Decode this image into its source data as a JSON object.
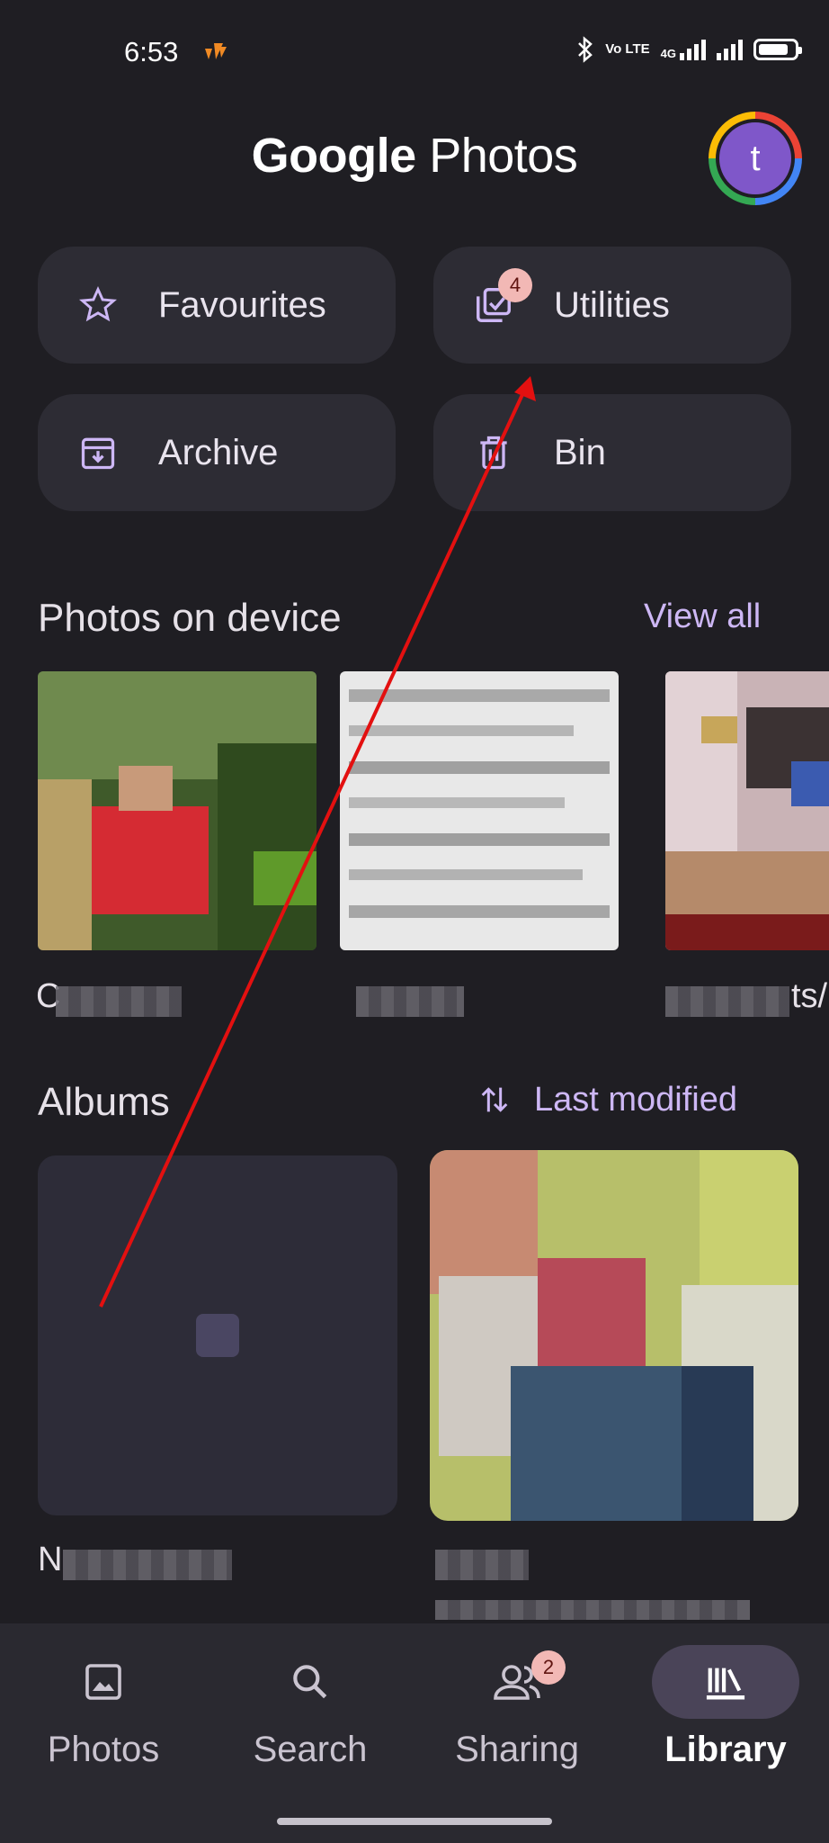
{
  "status_bar": {
    "time": "6:53",
    "network_text": "Vo LTE",
    "network_type": "4G"
  },
  "header": {
    "title_google": "Google",
    "title_photos": "Photos",
    "avatar_letter": "t"
  },
  "quick_actions": [
    {
      "label": "Favourites",
      "icon": "star-icon"
    },
    {
      "label": "Utilities",
      "icon": "utilities-icon",
      "badge": "4"
    },
    {
      "label": "Archive",
      "icon": "archive-icon"
    },
    {
      "label": "Bin",
      "icon": "trash-icon"
    }
  ],
  "photos_on_device": {
    "title": "Photos on device",
    "view_all": "View all",
    "caption_visible_chars": [
      "C",
      "",
      "ts/"
    ]
  },
  "albums": {
    "title": "Albums",
    "sort_label": "Last modified",
    "captions": [
      "N",
      ""
    ]
  },
  "bottom_nav": {
    "items": [
      {
        "label": "Photos",
        "icon": "photo-icon"
      },
      {
        "label": "Search",
        "icon": "search-icon"
      },
      {
        "label": "Sharing",
        "icon": "people-icon",
        "badge": "2"
      },
      {
        "label": "Library",
        "icon": "library-icon",
        "active": true
      }
    ]
  },
  "colors": {
    "background": "#1f1e23",
    "chip": "#2d2c34",
    "accent": "#cdb7f5",
    "annotation_arrow": "#e31010",
    "badge": "#f2b8b5"
  }
}
